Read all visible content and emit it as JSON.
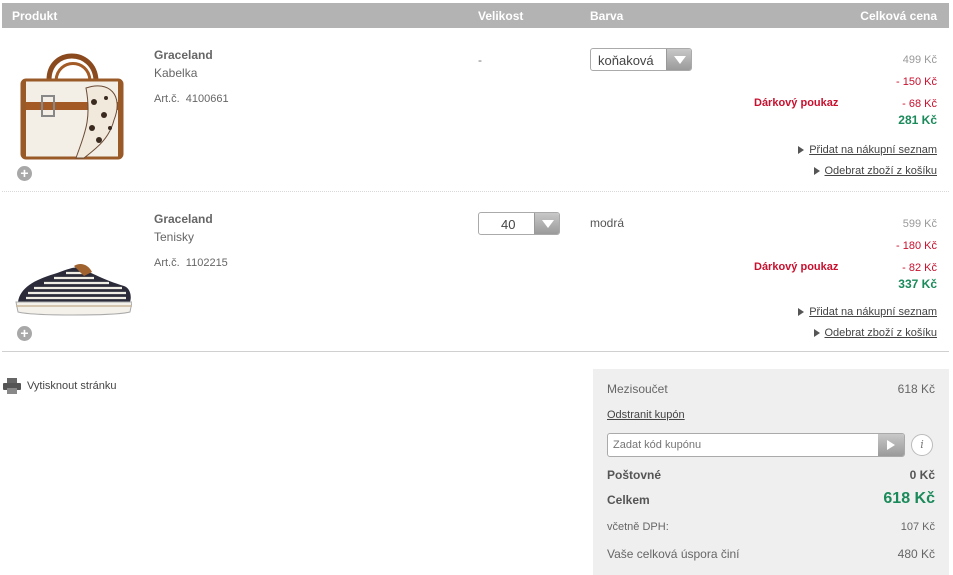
{
  "header": {
    "product": "Produkt",
    "size": "Velikost",
    "color": "Barva",
    "total_price": "Celková cena"
  },
  "items": [
    {
      "brand": "Graceland",
      "type": "Kabelka",
      "art_label": "Art.č.",
      "art_no": "4100661",
      "size": "-",
      "color": "koňaková",
      "price_original": "499 Kč",
      "price_discount": "- 150 Kč",
      "gift_label": "Dárkový poukaz",
      "gift_discount": "- 68 Kč",
      "price_final": "281 Kč",
      "icon": "handbag-image"
    },
    {
      "brand": "Graceland",
      "type": "Tenisky",
      "art_label": "Art.č.",
      "art_no": "1102215",
      "size": "40",
      "color": "modrá",
      "price_original": "599 Kč",
      "price_discount": "- 180 Kč",
      "gift_label": "Dárkový poukaz",
      "gift_discount": "- 82 Kč",
      "price_final": "337 Kč",
      "icon": "sneaker-image"
    }
  ],
  "links": {
    "add_to_list": "Přidat na nákupní seznam",
    "remove_item": "Odebrat zboží z košíku"
  },
  "print_label": "Vytisknout stránku",
  "summary": {
    "subtotal_label": "Mezisoučet",
    "subtotal_value": "618 Kč",
    "remove_coupon": "Odstranit kupón",
    "coupon_placeholder": "Zadat kód kupónu",
    "shipping_label": "Poštovné",
    "shipping_value": "0 Kč",
    "total_label": "Celkem",
    "total_value": "618 Kč",
    "vat_label": "včetně DPH:",
    "vat_value": "107 Kč",
    "savings_label": "Vaše celková úspora činí",
    "savings_value": "480 Kč"
  },
  "colors": {
    "header_bg": "#b3b3b3",
    "discount": "#c8102e",
    "final_price": "#1a8a5a",
    "summary_bg": "#efefef"
  }
}
